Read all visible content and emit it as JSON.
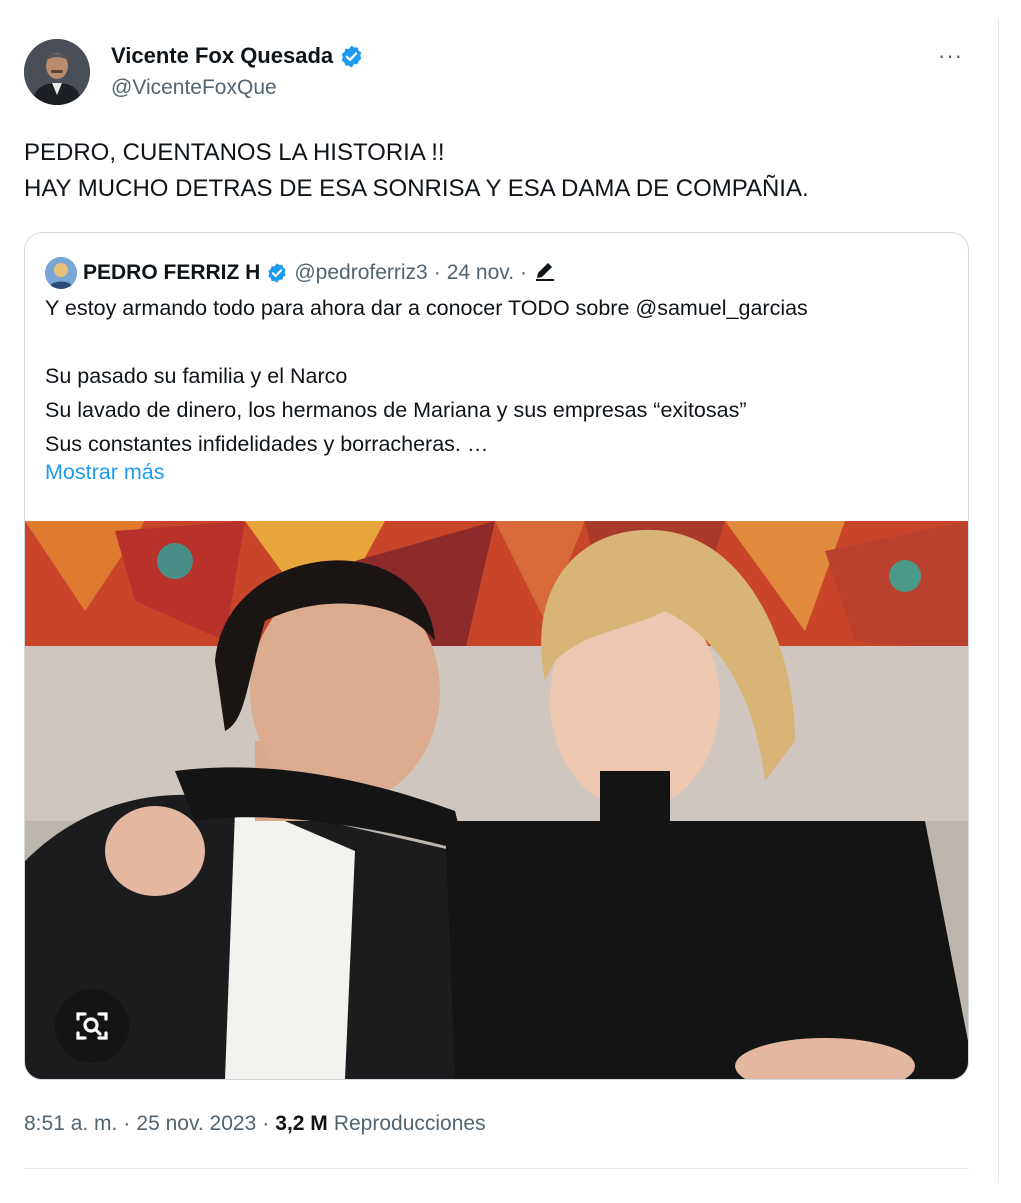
{
  "author": {
    "name": "Vicente Fox Quesada",
    "handle": "@VicenteFoxQue",
    "verified_color": "#1d9bf0"
  },
  "more_icon": "···",
  "tweet": {
    "line1": "PEDRO, CUENTANOS LA HISTORIA !!",
    "line2": "HAY MUCHO DETRAS DE ESA SONRISA Y ESA DAMA DE COMPAÑIA."
  },
  "quoted": {
    "name": "PEDRO FERRIZ H",
    "handle": "@pedroferriz3",
    "sep1": "·",
    "date": "24 nov.",
    "sep2": "·",
    "text": "Y estoy armando todo para ahora dar a conocer TODO sobre @samuel_garcias\n\nSu pasado su familia y  el Narco\nSu lavado de dinero, los hermanos de Mariana y sus empresas “exitosas”\nSus constantes infidelidades y borracheras. …",
    "show_more": "Mostrar más"
  },
  "meta": {
    "time": "8:51 a. m.",
    "sep1": "·",
    "date": "25 nov. 2023",
    "sep2": "·",
    "views": "3,2 M",
    "views_label": "Reproducciones"
  },
  "colors": {
    "link": "#1d9bf0",
    "secondary_text": "#536471",
    "border": "#cfd9de"
  }
}
